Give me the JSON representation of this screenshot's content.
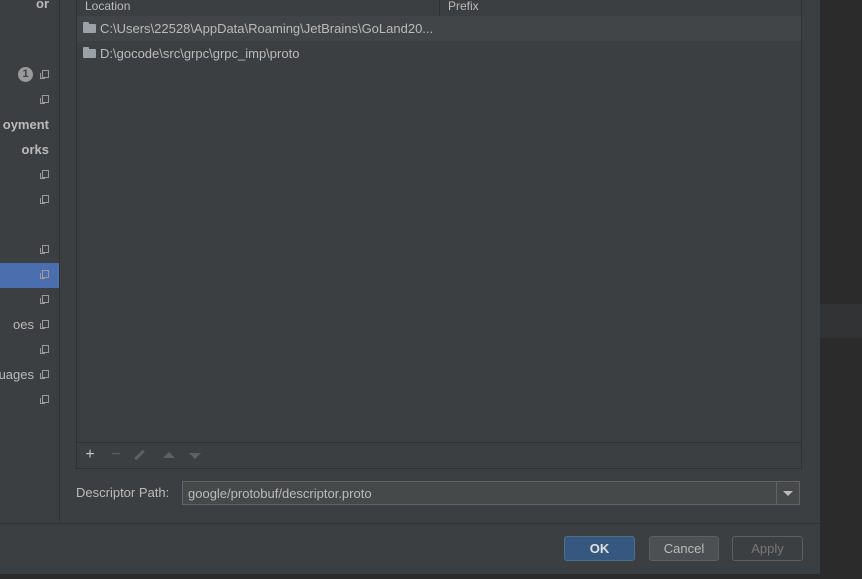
{
  "sidebar": {
    "items": [
      {
        "label": "or",
        "bold": true,
        "icon": false
      },
      {
        "label": "",
        "badge": "1",
        "icon": true
      },
      {
        "label": "",
        "icon": true
      },
      {
        "label": "oyment",
        "bold": true,
        "icon": false
      },
      {
        "label": "orks",
        "bold": true,
        "icon": false
      },
      {
        "label": "",
        "icon": true
      },
      {
        "label": "",
        "icon": true
      },
      {
        "label": "",
        "icon": true
      },
      {
        "label": "",
        "icon": true,
        "selected": true
      },
      {
        "label": "",
        "icon": true
      },
      {
        "label": "oes",
        "icon": true
      },
      {
        "label": "",
        "icon": true
      },
      {
        "label": "uages",
        "icon": true
      },
      {
        "label": "",
        "icon": true
      }
    ]
  },
  "table": {
    "columns": [
      "Location",
      "Prefix"
    ],
    "rows": [
      {
        "location": "C:\\Users\\22528\\AppData\\Roaming\\JetBrains\\GoLand20...",
        "prefix": ""
      },
      {
        "location": "D:\\gocode\\src\\grpc\\grpc_imp\\proto",
        "prefix": ""
      }
    ],
    "toolbar": {
      "add": "+",
      "remove": "−"
    }
  },
  "descriptor": {
    "label": "Descriptor Path:",
    "value": "google/protobuf/descriptor.proto"
  },
  "buttons": {
    "ok": "OK",
    "cancel": "Cancel",
    "apply": "Apply"
  },
  "colors": {
    "background": "#3c3f41",
    "selection": "#4b6eaf",
    "primary_button": "#365880"
  },
  "icons": {
    "row_icon": "folder-icon",
    "sidebar_icon": "copy-settings-icon",
    "combo_icon": "chevron-down-icon"
  }
}
